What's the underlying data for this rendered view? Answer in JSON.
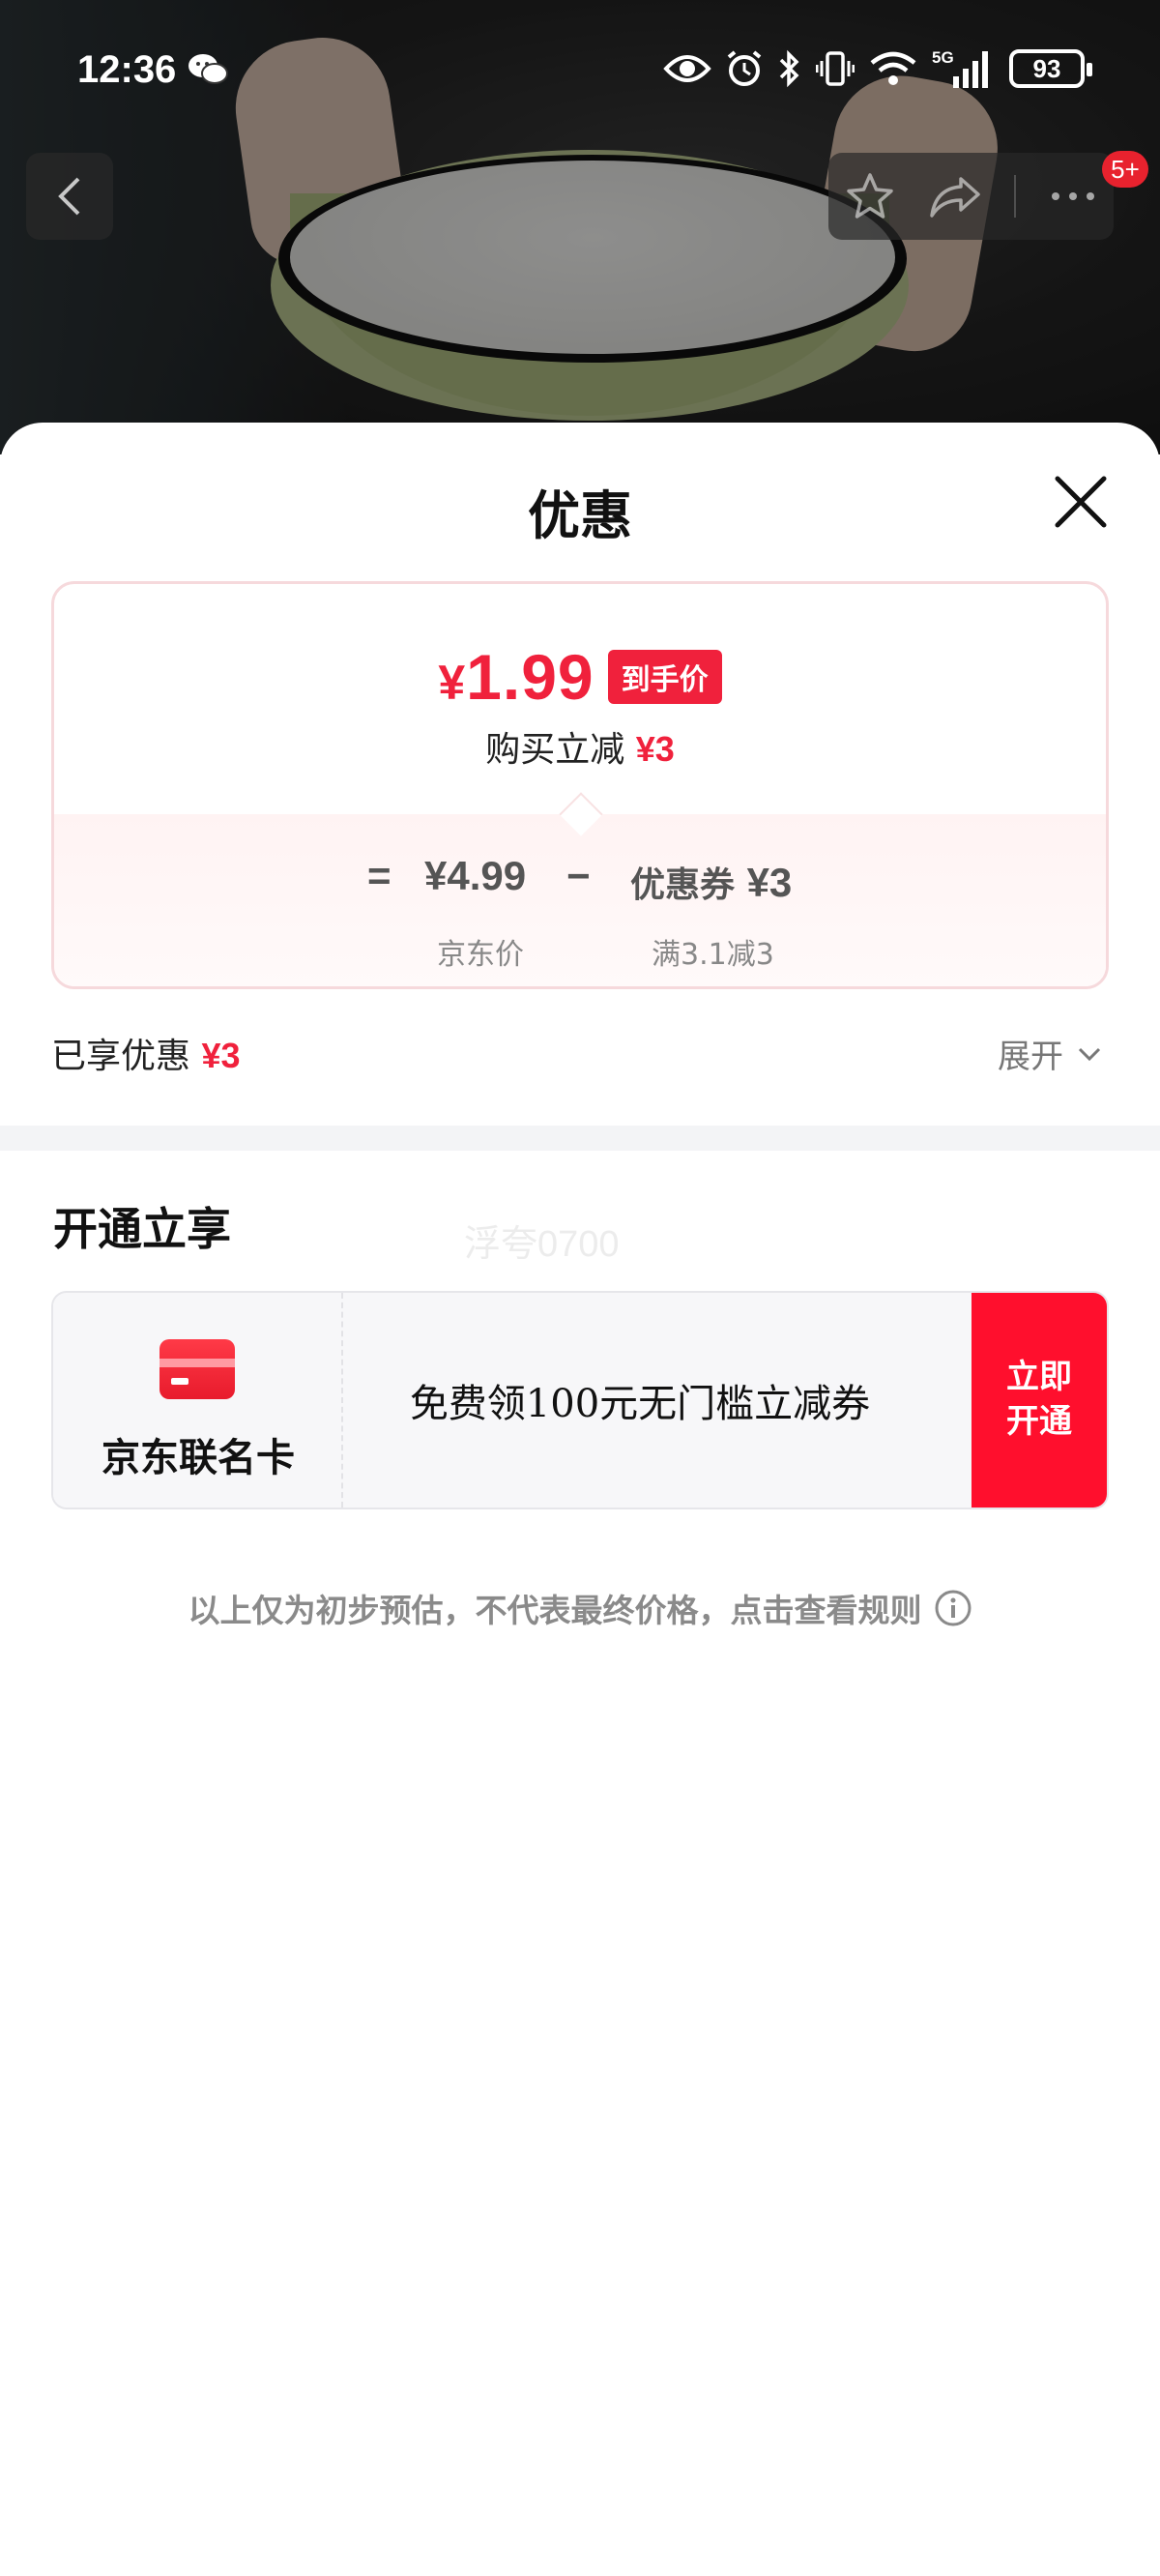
{
  "status_bar": {
    "time": "12:36",
    "battery": "93",
    "network": "5G"
  },
  "nav": {
    "badge": "5+"
  },
  "sheet": {
    "title": "优惠",
    "final_price": "1.99",
    "currency": "¥",
    "final_tag": "到手价",
    "reduce_label": "购买立减",
    "reduce_amount": "¥3",
    "formula": {
      "equals": "=",
      "base_price": "¥4.99",
      "minus": "−",
      "coupon_label": "优惠券",
      "coupon_amount": "¥3",
      "base_caption": "京东价",
      "coupon_caption": "满3.1减3"
    },
    "enjoyed_label": "已享优惠",
    "enjoyed_amount": "¥3",
    "expand_label": "展开"
  },
  "open_section": {
    "title": "开通立享",
    "watermark": "浮夸0700",
    "card_name": "京东联名卡",
    "card_desc": "免费领100元无门槛立减券",
    "button_line1": "立即",
    "button_line2": "开通"
  },
  "disclaimer": "以上仅为初步预估，不代表最终价格，点击查看规则",
  "colors": {
    "accent_red": "#f0213c",
    "button_red": "#ff0f2d"
  }
}
